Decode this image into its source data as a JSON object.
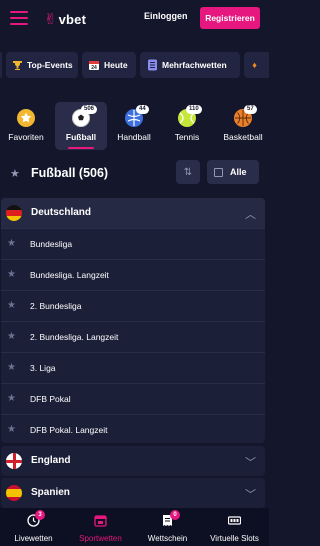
{
  "header": {
    "logo_text": "vbet",
    "login": "Einloggen",
    "register": "Registrieren"
  },
  "quick_links": [
    {
      "label": "Top-Events",
      "icon": "trophy-icon"
    },
    {
      "label": "Heute",
      "icon": "calendar-icon"
    },
    {
      "label": "Mehrfachwetten",
      "icon": "list-icon"
    }
  ],
  "sports": [
    {
      "label": "Favoriten",
      "count": "",
      "icon": "star-icon"
    },
    {
      "label": "Fußball",
      "count": "506",
      "icon": "soccer-ball-icon",
      "active": true
    },
    {
      "label": "Handball",
      "count": "44",
      "icon": "handball-icon"
    },
    {
      "label": "Tennis",
      "count": "110",
      "icon": "tennis-ball-icon"
    },
    {
      "label": "Basketball",
      "count": "57",
      "icon": "basketball-icon"
    }
  ],
  "section": {
    "title": "Fußball (506)",
    "filter_label": "Alle"
  },
  "countries": [
    {
      "name": "Deutschland",
      "expanded": true,
      "leagues": [
        "Bundesliga",
        "Bundesliga. Langzeit",
        "2. Bundesliga",
        "2. Bundesliga. Langzeit",
        "3. Liga",
        "DFB Pokal",
        "DFB Pokal. Langzeit"
      ]
    },
    {
      "name": "England",
      "expanded": false
    },
    {
      "name": "Spanien",
      "expanded": false
    }
  ],
  "bottom_nav": [
    {
      "label": "Livewetten",
      "badge": "3",
      "icon": "live-icon"
    },
    {
      "label": "Sportwetten",
      "badge": "",
      "icon": "sports-calendar-icon",
      "active": true
    },
    {
      "label": "Wettschein",
      "badge": "0",
      "icon": "betslip-icon"
    },
    {
      "label": "Virtuelle Slots",
      "badge": "",
      "icon": "slots-icon"
    }
  ],
  "colors": {
    "background": "#14162c",
    "accent": "#e6177e",
    "panel": "#1c1f38"
  }
}
